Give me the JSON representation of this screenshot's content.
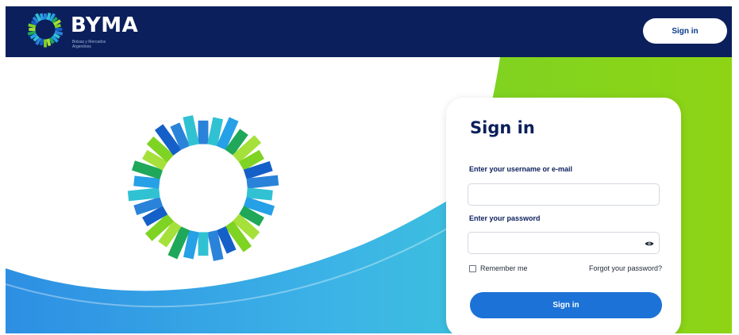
{
  "header": {
    "brand_name": "BYMA",
    "brand_subtitle": "Bolsas y Mercados Argentinos",
    "signin_label": "Sign in"
  },
  "login": {
    "title": "Sign in",
    "username_label": "Enter your username or e-mail",
    "username_value": "",
    "password_label": "Enter your password",
    "password_value": "",
    "remember_label": "Remember me",
    "remember_checked": false,
    "forgot_label": "Forgot your password?",
    "submit_label": "Sign in"
  },
  "icons": {
    "brand_logo": "byma-ring-logo",
    "hero": "byma-ring-logo",
    "password_toggle": "eye-icon"
  },
  "colors": {
    "navy": "#0b1f5c",
    "blue": "#1c72d6",
    "green": "#7ed321",
    "cyan": "#23c6d0"
  }
}
